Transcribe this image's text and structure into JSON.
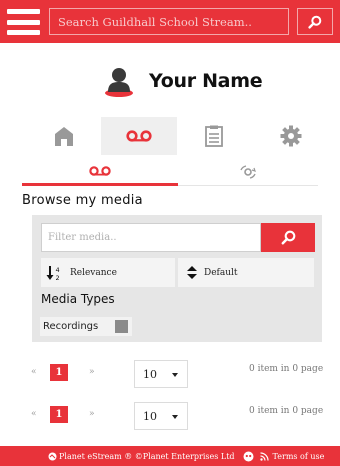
{
  "header": {
    "menu_icon": "hamburger-icon",
    "search": {
      "placeholder": "Search Guildhall School Stream..",
      "value": ""
    },
    "search_icon": "search-icon"
  },
  "profile": {
    "avatar_icon": "user-icon",
    "name": "Your Name"
  },
  "main_tabs": [
    {
      "icon": "home-icon",
      "active": false
    },
    {
      "icon": "recordings-icon",
      "active": true
    },
    {
      "icon": "clipboard-icon",
      "active": false
    },
    {
      "icon": "gear-icon",
      "active": false
    }
  ],
  "sub_tabs": [
    {
      "icon": "recordings-icon",
      "active": true
    },
    {
      "icon": "link-icon",
      "active": false
    }
  ],
  "browse": {
    "title": "Browse my media",
    "filter": {
      "placeholder": "Filter media..",
      "value": ""
    },
    "sort": {
      "label": "Relevance",
      "icon": "sort-numeric-icon"
    },
    "order": {
      "label": "Default",
      "icon": "sort-updown-icon"
    },
    "types_title": "Media Types",
    "types": [
      {
        "label": "Recordings",
        "checked": false
      }
    ]
  },
  "pagination": [
    {
      "prev": "«",
      "page": "1",
      "next": "»",
      "page_size": "10",
      "info": "0 item in 0 page"
    },
    {
      "prev": "«",
      "page": "1",
      "next": "»",
      "page_size": "10",
      "info": "0 item in 0 page"
    }
  ],
  "footer": {
    "copyright": "Planet eStream ® ©Planet Enterprises Ltd",
    "terms": "Terms of use"
  },
  "colors": {
    "accent": "#e8333a",
    "panel": "#e6e6e6",
    "icon_gray": "#999999"
  }
}
